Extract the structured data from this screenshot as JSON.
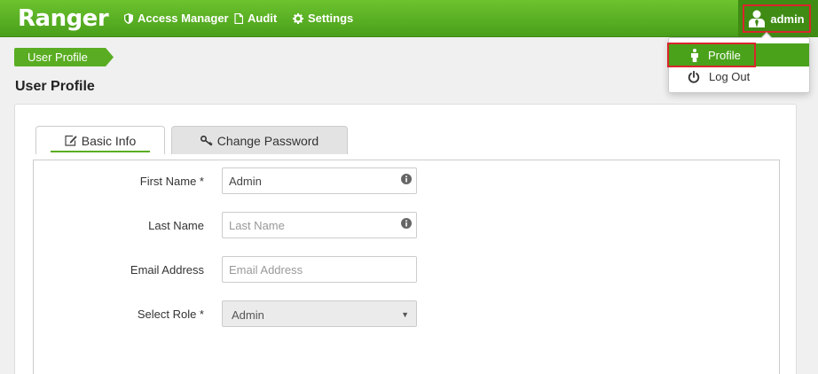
{
  "navbar": {
    "brand": "Ranger",
    "items": [
      {
        "label": "Access Manager",
        "icon": "shield-icon"
      },
      {
        "label": "Audit",
        "icon": "file-icon"
      },
      {
        "label": "Settings",
        "icon": "gear-icon"
      }
    ],
    "user": {
      "label": "admin",
      "icon": "user-icon"
    }
  },
  "dropdown": {
    "items": [
      {
        "label": "Profile",
        "icon": "person-icon"
      },
      {
        "label": "Log Out",
        "icon": "power-icon"
      }
    ]
  },
  "breadcrumb": "User Profile",
  "page_title": "User Profile",
  "tabs": [
    {
      "label": "Basic Info",
      "icon": "edit-icon",
      "active": true
    },
    {
      "label": "Change Password",
      "icon": "key-icon",
      "active": false
    }
  ],
  "form": {
    "first_name": {
      "label": "First Name *",
      "value": "Admin",
      "placeholder": "First Name"
    },
    "last_name": {
      "label": "Last Name",
      "value": "",
      "placeholder": "Last Name"
    },
    "email": {
      "label": "Email Address",
      "value": "",
      "placeholder": "Email Address"
    },
    "role": {
      "label": "Select Role *",
      "value": "Admin"
    }
  },
  "colors": {
    "accent": "#5aad22",
    "navbar": "#4a9f1b",
    "highlight": "#d9262c"
  }
}
